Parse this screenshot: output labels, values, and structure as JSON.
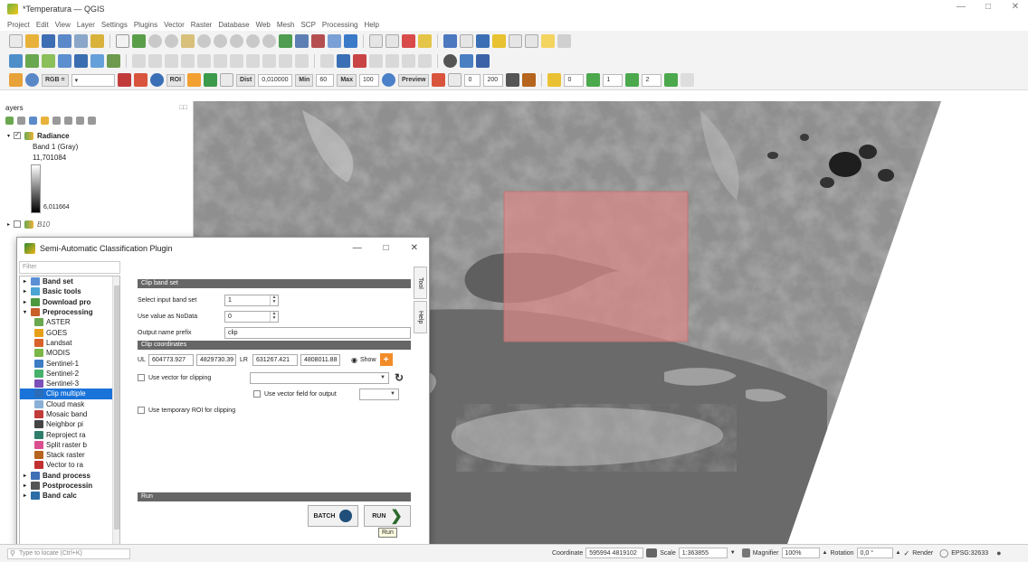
{
  "window": {
    "title": "*Temperatura — QGIS"
  },
  "menu": [
    "Project",
    "Edit",
    "View",
    "Layer",
    "Settings",
    "Plugins",
    "Vector",
    "Raster",
    "Database",
    "Web",
    "Mesh",
    "SCP",
    "Processing",
    "Help"
  ],
  "toolbar3": {
    "rgb": "RGB =",
    "roi": "ROI",
    "dist_label": "Dist",
    "dist_value": "0,010000",
    "min_label": "Min",
    "min_value": "60",
    "max_label": "Max",
    "max_value": "100",
    "preview": "Preview",
    "t_value": "0",
    "s_value": "200",
    "band_r": "0",
    "band_g": "1",
    "band_b": "2"
  },
  "layers": {
    "title": "ayers",
    "items": [
      {
        "name": "Radiance",
        "checked": true,
        "sub": "Band 1 (Gray)",
        "max": "11,701084",
        "min": "6,011664"
      },
      {
        "name": "B10",
        "checked": false
      }
    ]
  },
  "dialog": {
    "title": "Semi-Automatic Classification Plugin",
    "filter_placeholder": "Filter",
    "tree": [
      {
        "label": "Band set",
        "level": 0,
        "bold": true,
        "icon": "#5b8fd6"
      },
      {
        "label": "Basic tools",
        "level": 0,
        "bold": true,
        "icon": "#4ca4d4"
      },
      {
        "label": "Download pro",
        "level": 0,
        "bold": true,
        "icon": "#4c9a3d"
      },
      {
        "label": "Preprocessing",
        "level": 0,
        "bold": true,
        "icon": "#c8602a"
      },
      {
        "label": "ASTER",
        "level": 1,
        "bold": false,
        "icon": "#6aa84f"
      },
      {
        "label": "GOES",
        "level": 1,
        "bold": false,
        "icon": "#e6a017"
      },
      {
        "label": "Landsat",
        "level": 1,
        "bold": false,
        "icon": "#d9622b"
      },
      {
        "label": "MODIS",
        "level": 1,
        "bold": false,
        "icon": "#7ab648"
      },
      {
        "label": "Sentinel-1",
        "level": 1,
        "bold": false,
        "icon": "#3c7dc4"
      },
      {
        "label": "Sentinel-2",
        "level": 1,
        "bold": false,
        "icon": "#46b06c"
      },
      {
        "label": "Sentinel-3",
        "level": 1,
        "bold": false,
        "icon": "#7a4fb8"
      },
      {
        "label": "Clip multiple",
        "level": 1,
        "bold": false,
        "icon": "#2b6cb8",
        "selected": true
      },
      {
        "label": "Cloud mask",
        "level": 1,
        "bold": false,
        "icon": "#8ab0d6"
      },
      {
        "label": "Mosaic band",
        "level": 1,
        "bold": false,
        "icon": "#c23b3b"
      },
      {
        "label": "Neighbor pi",
        "level": 1,
        "bold": false,
        "icon": "#444444"
      },
      {
        "label": "Reproject ra",
        "level": 1,
        "bold": false,
        "icon": "#2f7d6b"
      },
      {
        "label": "Split raster b",
        "level": 1,
        "bold": false,
        "icon": "#d94f8f"
      },
      {
        "label": "Stack raster",
        "level": 1,
        "bold": false,
        "icon": "#b5651d"
      },
      {
        "label": "Vector to ra",
        "level": 1,
        "bold": false,
        "icon": "#c13030"
      },
      {
        "label": "Band process",
        "level": 0,
        "bold": true,
        "icon": "#3f6fb5"
      },
      {
        "label": "Postprocessin",
        "level": 0,
        "bold": true,
        "icon": "#555555"
      },
      {
        "label": "Band calc",
        "level": 0,
        "bold": true,
        "icon": "#2d6ea8"
      }
    ],
    "side_tabs": [
      "Tool",
      "Help"
    ],
    "clip_band_set": {
      "header": "Clip band set",
      "input_label": "Select input band set",
      "input_value": "1",
      "nodata_label": "Use value as NoData",
      "nodata_value": "0",
      "prefix_label": "Output name prefix",
      "prefix_value": "clip"
    },
    "clip_coords": {
      "header": "Clip coordinates",
      "ul_label": "UL",
      "ul_x": "604773.927",
      "ul_y": "4829730.39",
      "lr_label": "LR",
      "lr_x": "631267.421",
      "lr_y": "4808011.88",
      "show_label": "Show",
      "use_vector_label": "Use vector for clipping",
      "use_field_label": "Use vector field for output",
      "use_roi_label": "Use temporary ROI for clipping"
    },
    "run": {
      "header": "Run",
      "batch_label": "BATCH",
      "run_label": "RUN",
      "tooltip": "Run"
    }
  },
  "statusbar": {
    "locate_placeholder": "Type to locate (Ctrl+K)",
    "coordinate_label": "Coordinate",
    "coordinate_value": "595994 4819102",
    "scale_label": "Scale",
    "scale_value": "1:363855",
    "magnifier_label": "Magnifier",
    "magnifier_value": "100%",
    "rotation_label": "Rotation",
    "rotation_value": "0,0 °",
    "render_label": "Render",
    "crs": "EPSG:32633"
  },
  "colors": {
    "selection": "#1a73d9",
    "roi_fill": "#d98888",
    "section_header": "#666666"
  }
}
